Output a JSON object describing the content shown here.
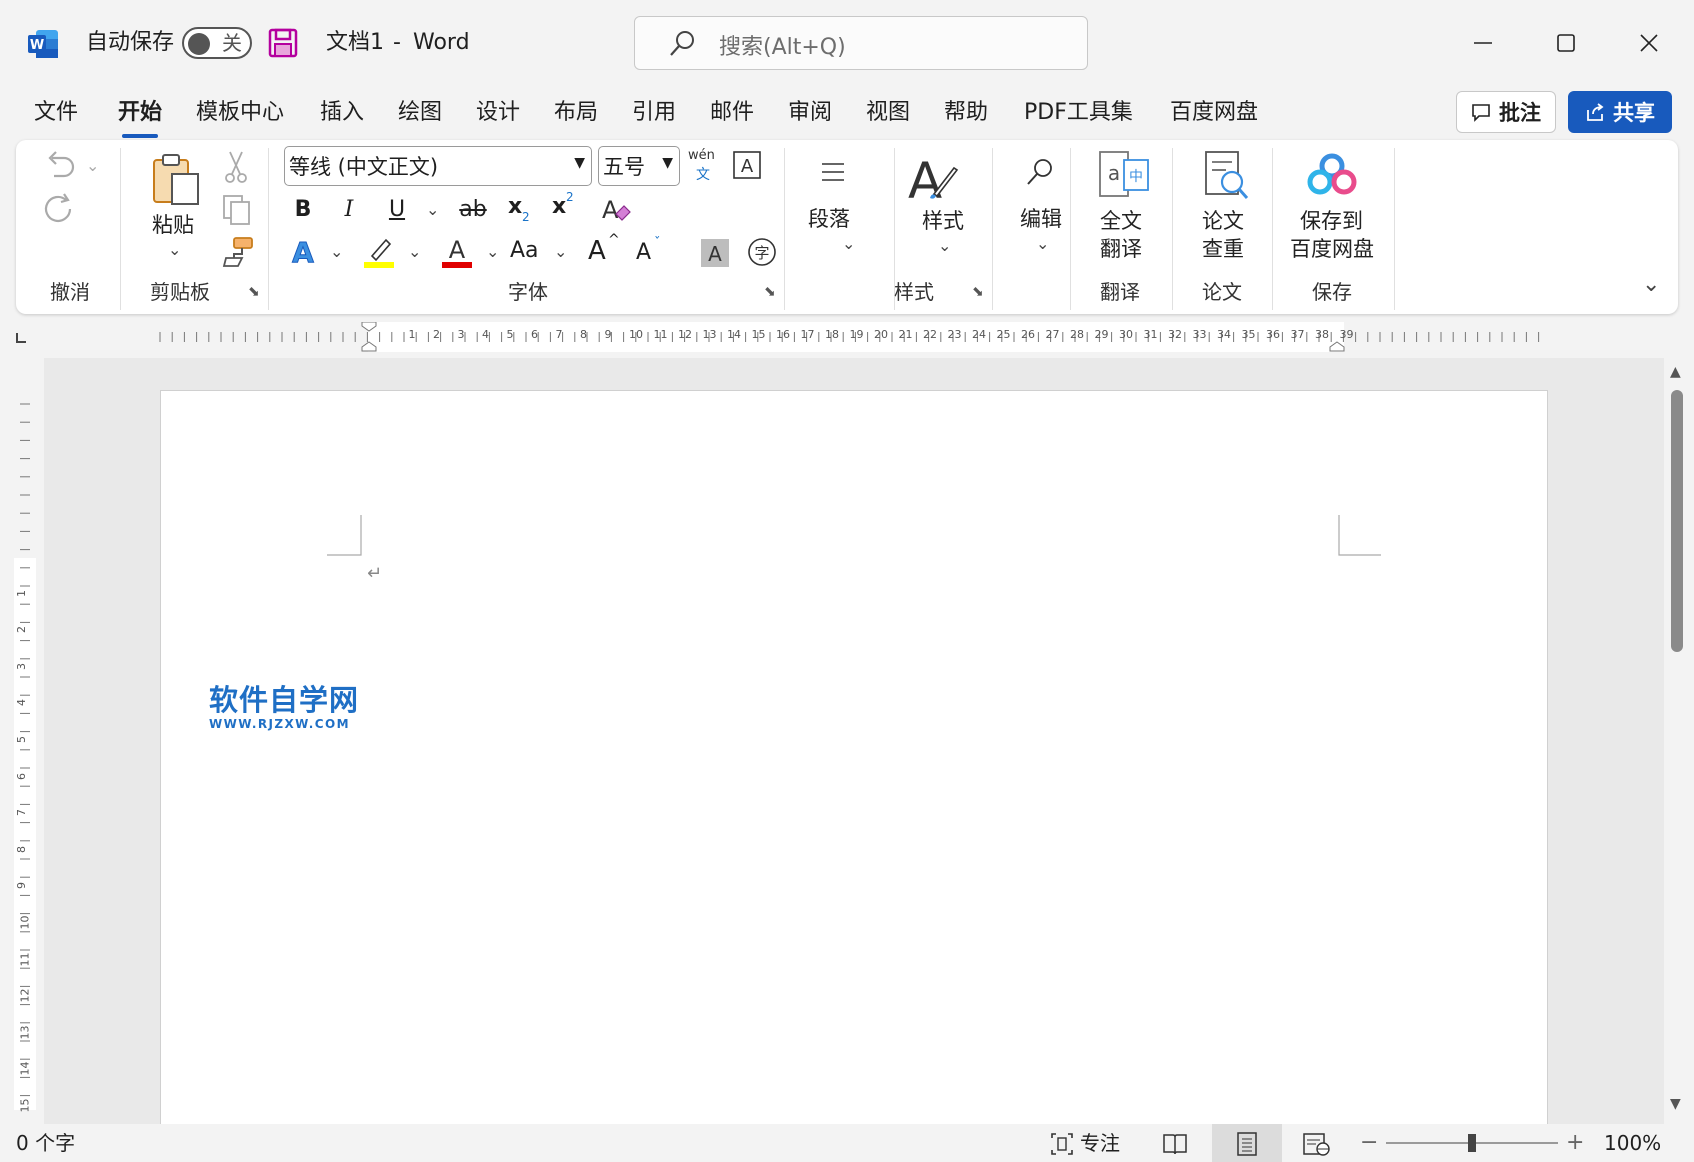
{
  "titlebar": {
    "autosave_label": "自动保存",
    "autosave_state": "关",
    "doc_title": "文档1",
    "title_sep": "-",
    "app_name": "Word",
    "search_placeholder": "搜索(Alt+Q)"
  },
  "tabs": [
    "文件",
    "开始",
    "模板中心",
    "插入",
    "绘图",
    "设计",
    "布局",
    "引用",
    "邮件",
    "审阅",
    "视图",
    "帮助",
    "PDF工具集",
    "百度网盘"
  ],
  "active_tab": "开始",
  "actions": {
    "comment": "批注",
    "share": "共享"
  },
  "ribbon": {
    "undo_group": "撤消",
    "clipboard": {
      "paste": "粘贴",
      "group": "剪贴板"
    },
    "font": {
      "family": "等线 (中文正文)",
      "size": "五号",
      "phonetic_top": "wén",
      "phonetic_bottom": "文",
      "bold": "B",
      "italic": "I",
      "underline": "U",
      "strike": "ab",
      "subscript": "x",
      "superscript": "x",
      "change_case": "Aa",
      "grow": "A",
      "shrink": "A",
      "group": "字体"
    },
    "paragraph": "段落",
    "styles": {
      "button": "样式",
      "group": "样式"
    },
    "editing": "编辑",
    "translate": {
      "button_line1": "全文",
      "button_line2": "翻译",
      "group": "翻译"
    },
    "paper": {
      "button_line1": "论文",
      "button_line2": "查重",
      "group": "论文"
    },
    "save": {
      "button_line1": "保存到",
      "button_line2": "百度网盘",
      "group": "保存"
    }
  },
  "ruler": {
    "h_numbers": [
      "1",
      "2",
      "3",
      "4",
      "5",
      "6",
      "7",
      "8",
      "9",
      "10",
      "11",
      "12",
      "13",
      "14",
      "15",
      "16",
      "17",
      "18",
      "19",
      "20",
      "21",
      "22",
      "23",
      "24",
      "25",
      "26",
      "27",
      "28",
      "29",
      "30",
      "31",
      "32",
      "33",
      "34",
      "35",
      "36",
      "37",
      "38",
      "39"
    ],
    "v_numbers": [
      "1",
      "2",
      "3",
      "4",
      "5",
      "6",
      "7",
      "8",
      "9",
      "10",
      "11",
      "12",
      "13",
      "14",
      "15"
    ]
  },
  "document": {
    "watermark_title": "软件自学网",
    "watermark_url": "WWW.RJZXW.COM",
    "paragraph_mark": "↵"
  },
  "statusbar": {
    "word_count": "0 个字",
    "focus": "专注",
    "zoom": "100%"
  },
  "colors": {
    "accent": "#185abd",
    "highlight": "#ffff00",
    "font_color": "#e00000"
  }
}
